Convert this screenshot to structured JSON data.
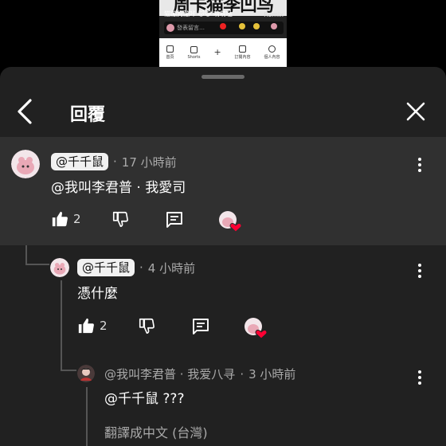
{
  "background_video": {
    "title": "周卡猫李凹鸟",
    "caption": "猫蹦狗蹦咔 🐱😺 萌萌哒",
    "remix_label": "Remix",
    "comment_preview": "發表留言…",
    "nav": [
      {
        "icon": "home-icon",
        "label": "首頁"
      },
      {
        "icon": "shorts-icon",
        "label": "Shorts"
      },
      {
        "icon": "plus-icon",
        "label": ""
      },
      {
        "icon": "subscriptions-icon",
        "label": "訂閱內容"
      },
      {
        "icon": "library-icon",
        "label": "個人內容"
      }
    ]
  },
  "header": {
    "title": "回覆",
    "back_icon": "chevron-left-icon",
    "close_icon": "close-icon"
  },
  "colors": {
    "panel_bg": "#212121",
    "highlight_bg": "#303030",
    "tag_bg": "#f1f1f1",
    "secondary_text": "#aaaaaa",
    "heart": "#ff0033"
  },
  "comments": [
    {
      "author": "@千千鼠",
      "time": "17 小時前",
      "text": "@我叫李君普 · 我愛司",
      "likes": "2",
      "highlighted": true
    },
    {
      "author": "@千千鼠",
      "time": "4 小時前",
      "text": "憑什麼",
      "likes": "2",
      "highlighted": false
    },
    {
      "author": "@我叫李君普 · 我爱八寻",
      "time": "3 小時前",
      "text": "@千千鼠 ???",
      "translate": "翻譯成中文 (台灣)"
    }
  ],
  "separator": "·"
}
